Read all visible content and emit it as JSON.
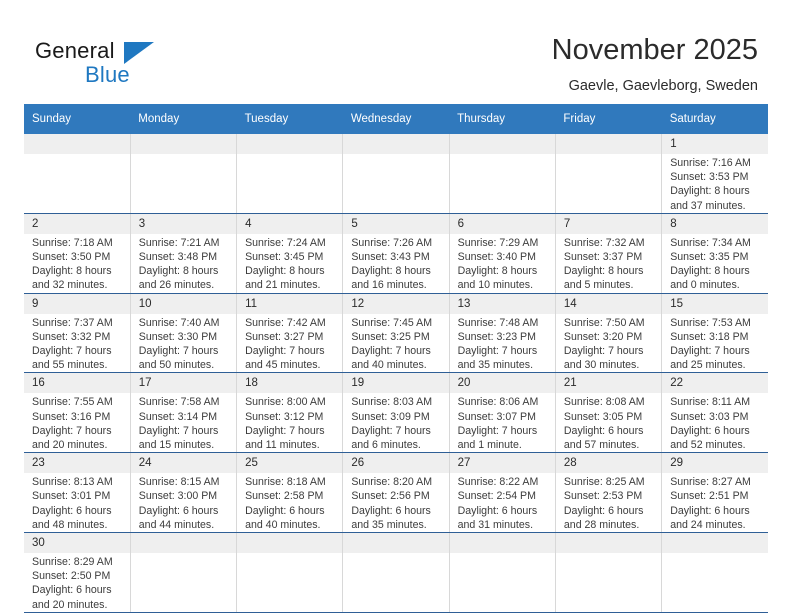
{
  "brand": {
    "name_top": "General",
    "name_bottom": "Blue",
    "flag_icon": "blue-flag-triangle",
    "accent_color": "#1f78c1"
  },
  "header": {
    "title": "November 2025",
    "location": "Gaevle, Gaevleborg, Sweden"
  },
  "calendar": {
    "header_bg": "#3079bd",
    "daynum_bg": "#efefef",
    "row_divider_color": "#2f5f96",
    "weekdays": [
      "Sunday",
      "Monday",
      "Tuesday",
      "Wednesday",
      "Thursday",
      "Friday",
      "Saturday"
    ],
    "weeks": [
      [
        {
          "day": "",
          "lines": []
        },
        {
          "day": "",
          "lines": []
        },
        {
          "day": "",
          "lines": []
        },
        {
          "day": "",
          "lines": []
        },
        {
          "day": "",
          "lines": []
        },
        {
          "day": "",
          "lines": []
        },
        {
          "day": "1",
          "lines": [
            "Sunrise: 7:16 AM",
            "Sunset: 3:53 PM",
            "Daylight: 8 hours",
            "and 37 minutes."
          ]
        }
      ],
      [
        {
          "day": "2",
          "lines": [
            "Sunrise: 7:18 AM",
            "Sunset: 3:50 PM",
            "Daylight: 8 hours",
            "and 32 minutes."
          ]
        },
        {
          "day": "3",
          "lines": [
            "Sunrise: 7:21 AM",
            "Sunset: 3:48 PM",
            "Daylight: 8 hours",
            "and 26 minutes."
          ]
        },
        {
          "day": "4",
          "lines": [
            "Sunrise: 7:24 AM",
            "Sunset: 3:45 PM",
            "Daylight: 8 hours",
            "and 21 minutes."
          ]
        },
        {
          "day": "5",
          "lines": [
            "Sunrise: 7:26 AM",
            "Sunset: 3:43 PM",
            "Daylight: 8 hours",
            "and 16 minutes."
          ]
        },
        {
          "day": "6",
          "lines": [
            "Sunrise: 7:29 AM",
            "Sunset: 3:40 PM",
            "Daylight: 8 hours",
            "and 10 minutes."
          ]
        },
        {
          "day": "7",
          "lines": [
            "Sunrise: 7:32 AM",
            "Sunset: 3:37 PM",
            "Daylight: 8 hours",
            "and 5 minutes."
          ]
        },
        {
          "day": "8",
          "lines": [
            "Sunrise: 7:34 AM",
            "Sunset: 3:35 PM",
            "Daylight: 8 hours",
            "and 0 minutes."
          ]
        }
      ],
      [
        {
          "day": "9",
          "lines": [
            "Sunrise: 7:37 AM",
            "Sunset: 3:32 PM",
            "Daylight: 7 hours",
            "and 55 minutes."
          ]
        },
        {
          "day": "10",
          "lines": [
            "Sunrise: 7:40 AM",
            "Sunset: 3:30 PM",
            "Daylight: 7 hours",
            "and 50 minutes."
          ]
        },
        {
          "day": "11",
          "lines": [
            "Sunrise: 7:42 AM",
            "Sunset: 3:27 PM",
            "Daylight: 7 hours",
            "and 45 minutes."
          ]
        },
        {
          "day": "12",
          "lines": [
            "Sunrise: 7:45 AM",
            "Sunset: 3:25 PM",
            "Daylight: 7 hours",
            "and 40 minutes."
          ]
        },
        {
          "day": "13",
          "lines": [
            "Sunrise: 7:48 AM",
            "Sunset: 3:23 PM",
            "Daylight: 7 hours",
            "and 35 minutes."
          ]
        },
        {
          "day": "14",
          "lines": [
            "Sunrise: 7:50 AM",
            "Sunset: 3:20 PM",
            "Daylight: 7 hours",
            "and 30 minutes."
          ]
        },
        {
          "day": "15",
          "lines": [
            "Sunrise: 7:53 AM",
            "Sunset: 3:18 PM",
            "Daylight: 7 hours",
            "and 25 minutes."
          ]
        }
      ],
      [
        {
          "day": "16",
          "lines": [
            "Sunrise: 7:55 AM",
            "Sunset: 3:16 PM",
            "Daylight: 7 hours",
            "and 20 minutes."
          ]
        },
        {
          "day": "17",
          "lines": [
            "Sunrise: 7:58 AM",
            "Sunset: 3:14 PM",
            "Daylight: 7 hours",
            "and 15 minutes."
          ]
        },
        {
          "day": "18",
          "lines": [
            "Sunrise: 8:00 AM",
            "Sunset: 3:12 PM",
            "Daylight: 7 hours",
            "and 11 minutes."
          ]
        },
        {
          "day": "19",
          "lines": [
            "Sunrise: 8:03 AM",
            "Sunset: 3:09 PM",
            "Daylight: 7 hours",
            "and 6 minutes."
          ]
        },
        {
          "day": "20",
          "lines": [
            "Sunrise: 8:06 AM",
            "Sunset: 3:07 PM",
            "Daylight: 7 hours",
            "and 1 minute."
          ]
        },
        {
          "day": "21",
          "lines": [
            "Sunrise: 8:08 AM",
            "Sunset: 3:05 PM",
            "Daylight: 6 hours",
            "and 57 minutes."
          ]
        },
        {
          "day": "22",
          "lines": [
            "Sunrise: 8:11 AM",
            "Sunset: 3:03 PM",
            "Daylight: 6 hours",
            "and 52 minutes."
          ]
        }
      ],
      [
        {
          "day": "23",
          "lines": [
            "Sunrise: 8:13 AM",
            "Sunset: 3:01 PM",
            "Daylight: 6 hours",
            "and 48 minutes."
          ]
        },
        {
          "day": "24",
          "lines": [
            "Sunrise: 8:15 AM",
            "Sunset: 3:00 PM",
            "Daylight: 6 hours",
            "and 44 minutes."
          ]
        },
        {
          "day": "25",
          "lines": [
            "Sunrise: 8:18 AM",
            "Sunset: 2:58 PM",
            "Daylight: 6 hours",
            "and 40 minutes."
          ]
        },
        {
          "day": "26",
          "lines": [
            "Sunrise: 8:20 AM",
            "Sunset: 2:56 PM",
            "Daylight: 6 hours",
            "and 35 minutes."
          ]
        },
        {
          "day": "27",
          "lines": [
            "Sunrise: 8:22 AM",
            "Sunset: 2:54 PM",
            "Daylight: 6 hours",
            "and 31 minutes."
          ]
        },
        {
          "day": "28",
          "lines": [
            "Sunrise: 8:25 AM",
            "Sunset: 2:53 PM",
            "Daylight: 6 hours",
            "and 28 minutes."
          ]
        },
        {
          "day": "29",
          "lines": [
            "Sunrise: 8:27 AM",
            "Sunset: 2:51 PM",
            "Daylight: 6 hours",
            "and 24 minutes."
          ]
        }
      ],
      [
        {
          "day": "30",
          "lines": [
            "Sunrise: 8:29 AM",
            "Sunset: 2:50 PM",
            "Daylight: 6 hours",
            "and 20 minutes."
          ]
        },
        {
          "day": "",
          "lines": []
        },
        {
          "day": "",
          "lines": []
        },
        {
          "day": "",
          "lines": []
        },
        {
          "day": "",
          "lines": []
        },
        {
          "day": "",
          "lines": []
        },
        {
          "day": "",
          "lines": []
        }
      ]
    ]
  }
}
